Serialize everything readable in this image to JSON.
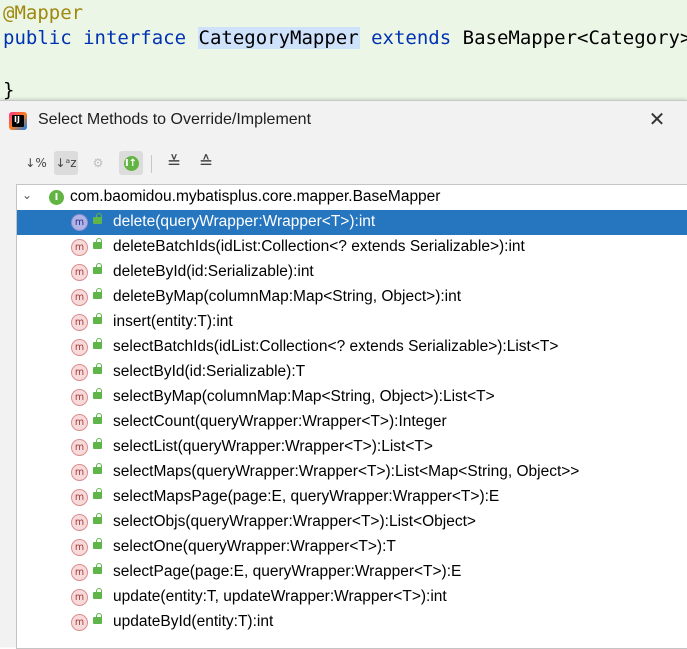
{
  "editor": {
    "annotation": "@Mapper",
    "kw_public": "public",
    "kw_interface": "interface",
    "class_name": "CategoryMapper",
    "kw_extends": "extends",
    "super_type": "BaseMapper<Category>",
    "open_brace": "{",
    "close_brace": "}"
  },
  "dialog": {
    "title": "Select Methods to Override/Implement",
    "close_glyph": "✕",
    "toolbar": {
      "sort_visibility": "↓%",
      "sort_alpha": "↓ᵃz",
      "show_inherited": "⚙",
      "show_interfaces": "I↑",
      "expand_all": "≚",
      "collapse_all": "≙"
    },
    "tree": {
      "root_label": "com.baomidou.mybatisplus.core.mapper.BaseMapper",
      "root_icon_letter": "I",
      "method_icon_letter": "m",
      "selected_index": 0,
      "methods": [
        "delete(queryWrapper:Wrapper<T>):int",
        "deleteBatchIds(idList:Collection<? extends Serializable>):int",
        "deleteById(id:Serializable):int",
        "deleteByMap(columnMap:Map<String, Object>):int",
        "insert(entity:T):int",
        "selectBatchIds(idList:Collection<? extends Serializable>):List<T>",
        "selectById(id:Serializable):T",
        "selectByMap(columnMap:Map<String, Object>):List<T>",
        "selectCount(queryWrapper:Wrapper<T>):Integer",
        "selectList(queryWrapper:Wrapper<T>):List<T>",
        "selectMaps(queryWrapper:Wrapper<T>):List<Map<String, Object>>",
        "selectMapsPage(page:E, queryWrapper:Wrapper<T>):E",
        "selectObjs(queryWrapper:Wrapper<T>):List<Object>",
        "selectOne(queryWrapper:Wrapper<T>):T",
        "selectPage(page:E, queryWrapper:Wrapper<T>):E",
        "update(entity:T, updateWrapper:Wrapper<T>):int",
        "updateById(entity:T):int"
      ]
    }
  },
  "colors": {
    "editor_bg": "#ecf6e6",
    "keyword": "#0033b3",
    "annotation": "#9e880d",
    "selection": "#2675bf"
  }
}
